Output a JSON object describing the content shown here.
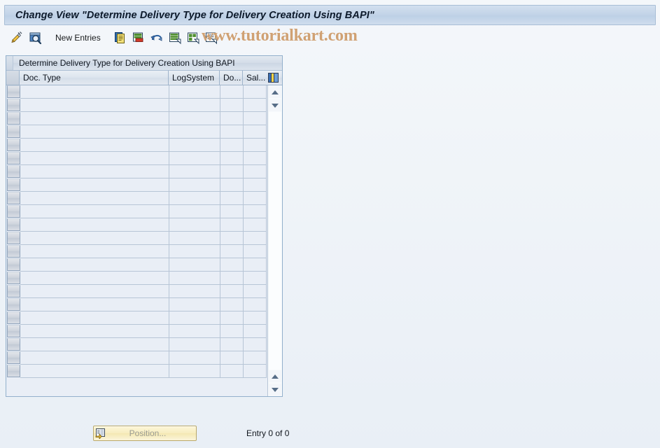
{
  "window": {
    "title": "Change View \"Determine Delivery Type for Delivery Creation Using BAPI\""
  },
  "toolbar": {
    "items": [
      {
        "name": "display-change-icon",
        "label": "",
        "icon": "pencil-display-change-icon"
      },
      {
        "name": "display-detail-icon",
        "label": "",
        "icon": "magnifier-window-icon"
      },
      {
        "name": "new-entries-button",
        "label": "New Entries",
        "icon": ""
      },
      {
        "name": "copy-as-icon",
        "label": "",
        "icon": "copy-pages-icon"
      },
      {
        "name": "delete-icon",
        "label": "",
        "icon": "delete-row-icon"
      },
      {
        "name": "undo-icon",
        "label": "",
        "icon": "undo-arrow-icon"
      },
      {
        "name": "select-all-icon",
        "label": "",
        "icon": "select-all-list-icon"
      },
      {
        "name": "select-block-icon",
        "label": "",
        "icon": "select-block-icon"
      },
      {
        "name": "deselect-all-icon",
        "label": "",
        "icon": "deselect-all-list-icon"
      }
    ],
    "new_entries_label": "New Entries"
  },
  "watermark": {
    "text": "www.tutorialkart.com",
    "color": "#d0a173"
  },
  "table": {
    "caption": "Determine Delivery Type for Delivery Creation Using BAPI",
    "columns": [
      {
        "key": "doc_type",
        "label": "Doc. Type"
      },
      {
        "key": "log_system",
        "label": "LogSystem"
      },
      {
        "key": "do",
        "label": "Do..."
      },
      {
        "key": "sal",
        "label": "Sal..."
      }
    ],
    "config_icon": "column-settings-icon",
    "rows": [],
    "empty_row_count": 22,
    "scroll": {
      "up_icon": "scroll-up-arrow-icon",
      "down_icon": "scroll-down-arrow-icon"
    }
  },
  "footer": {
    "position_button_label": "Position...",
    "position_button_icon": "position-list-icon",
    "entry_status": "Entry 0 of 0"
  },
  "colors": {
    "title_bar": "#c3d4e8",
    "background": "#e9eff6",
    "grid_line": "#b7c5d6",
    "panel_border": "#93b0cc",
    "button_yellow": "#f7edbf"
  }
}
